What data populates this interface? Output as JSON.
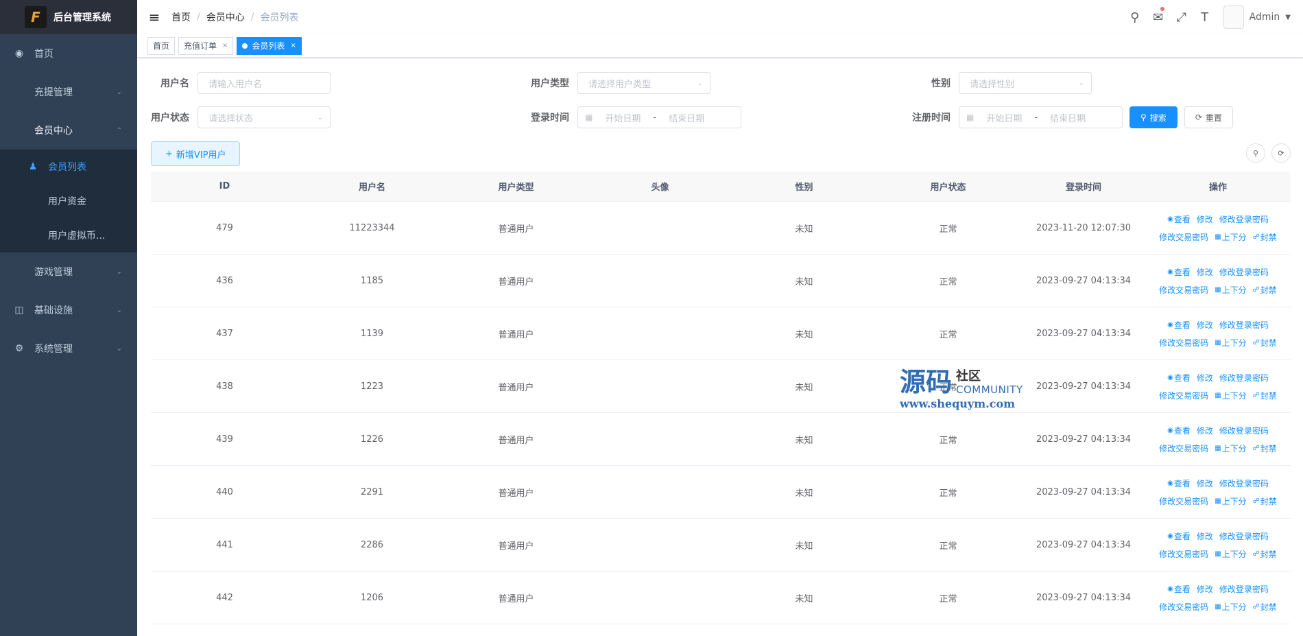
{
  "app": {
    "title": "后台管理系统",
    "logo_text": "F"
  },
  "sidebar": {
    "items": [
      {
        "label": "首页",
        "icon": "dashboard-icon"
      },
      {
        "label": "充提管理",
        "icon": ""
      },
      {
        "label": "会员中心",
        "icon": ""
      },
      {
        "label": "游戏管理",
        "icon": ""
      },
      {
        "label": "基础设施",
        "icon": "monitor-icon"
      },
      {
        "label": "系统管理",
        "icon": "gear-icon"
      }
    ],
    "submenu": [
      {
        "label": "会员列表",
        "icon": "user-icon"
      },
      {
        "label": "用户资金"
      },
      {
        "label": "用户虚拟币..."
      }
    ]
  },
  "breadcrumb": [
    "首页",
    "会员中心",
    "会员列表"
  ],
  "header": {
    "user": "Admin"
  },
  "tags": [
    {
      "label": "首页"
    },
    {
      "label": "充值订单"
    },
    {
      "label": "会员列表"
    }
  ],
  "filters": {
    "username": {
      "label": "用户名",
      "placeholder": "请输入用户名"
    },
    "user_type": {
      "label": "用户类型",
      "placeholder": "请选择用户类型"
    },
    "gender": {
      "label": "性别",
      "placeholder": "请选择性别"
    },
    "user_status": {
      "label": "用户状态",
      "placeholder": "请选择状态"
    },
    "login_time": {
      "label": "登录时间",
      "start": "开始日期",
      "end": "结束日期",
      "sep": "-"
    },
    "register_time": {
      "label": "注册时间",
      "start": "开始日期",
      "end": "结束日期",
      "sep": "-"
    },
    "search_btn": "搜索",
    "reset_btn": "重置"
  },
  "toolbar": {
    "add_btn": "新增VIP用户"
  },
  "table": {
    "columns": [
      "ID",
      "用户名",
      "用户类型",
      "头像",
      "性别",
      "用户状态",
      "登录时间",
      "操作"
    ],
    "ops": {
      "view": "查看",
      "edit": "修改",
      "change_login_pwd": "修改登录密码",
      "change_trade_pwd": "修改交易密码",
      "adjust": "上下分",
      "ban": "封禁"
    },
    "rows": [
      {
        "id": "479",
        "name": "11223344",
        "type": "普通用户",
        "gender": "未知",
        "status": "正常",
        "login": "2023-11-20 12:07:30"
      },
      {
        "id": "436",
        "name": "1185",
        "type": "普通用户",
        "gender": "未知",
        "status": "正常",
        "login": "2023-09-27 04:13:34"
      },
      {
        "id": "437",
        "name": "1139",
        "type": "普通用户",
        "gender": "未知",
        "status": "正常",
        "login": "2023-09-27 04:13:34"
      },
      {
        "id": "438",
        "name": "1223",
        "type": "普通用户",
        "gender": "未知",
        "status": "正常",
        "login": "2023-09-27 04:13:34"
      },
      {
        "id": "439",
        "name": "1226",
        "type": "普通用户",
        "gender": "未知",
        "status": "正常",
        "login": "2023-09-27 04:13:34"
      },
      {
        "id": "440",
        "name": "2291",
        "type": "普通用户",
        "gender": "未知",
        "status": "正常",
        "login": "2023-09-27 04:13:34"
      },
      {
        "id": "441",
        "name": "2286",
        "type": "普通用户",
        "gender": "未知",
        "status": "正常",
        "login": "2023-09-27 04:13:34"
      },
      {
        "id": "442",
        "name": "1206",
        "type": "普通用户",
        "gender": "未知",
        "status": "正常",
        "login": "2023-09-27 04:13:34"
      }
    ]
  },
  "watermark": {
    "big": "源码",
    "cn": "社区",
    "en": "COMMUNITY",
    "url": "www.shequym.com"
  },
  "colors": {
    "sidebar_bg": "#304156",
    "primary": "#1890ff",
    "submenu_bg": "#1f2d3d"
  }
}
